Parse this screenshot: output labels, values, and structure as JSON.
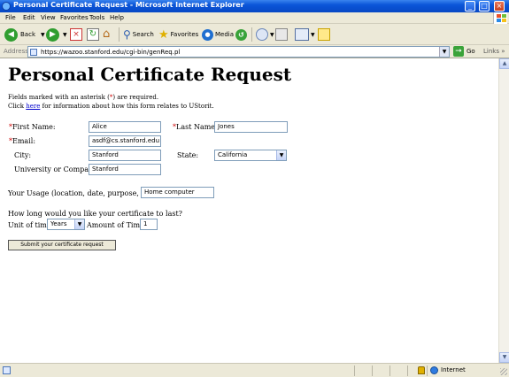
{
  "window": {
    "title": "Personal Certificate Request - Microsoft Internet Explorer",
    "minimize": "_",
    "maximize": "□",
    "close": "×"
  },
  "menu": [
    "File",
    "Edit",
    "View",
    "Favorites",
    "Tools",
    "Help"
  ],
  "toolbar": {
    "back": "Back",
    "search": "Search",
    "favorites": "Favorites",
    "media": "Media"
  },
  "address": {
    "label": "Address",
    "url": "https://wazoo.stanford.edu/cgi-bin/genReq.pl",
    "go": "Go",
    "links": "Links"
  },
  "page": {
    "title": "Personal Certificate Request",
    "required_note_pre": "Fields marked with an asterisk (",
    "asterisk": "*",
    "required_note_post": ") are required.",
    "click": "Click ",
    "here": "here",
    "info_post": " for information about how this form relates to UStorit."
  },
  "form": {
    "first_name_label": "First Name:",
    "first_name_value": "Alice",
    "last_name_label": "Last Name:",
    "last_name_value": "Jones",
    "email_label": "Email:",
    "email_value": "asdf@cs.stanford.edu",
    "city_label": "City:",
    "city_value": "Stanford",
    "state_label": "State:",
    "state_value": "California",
    "university_label": "University or Company:",
    "university_value": "Stanford",
    "usage_label": "Your Usage (location, date, purpose, etc.):",
    "usage_value": "Home computer",
    "duration_question": "How long would you like your certificate to last?",
    "unit_label": "Unit of time:",
    "unit_value": "Years",
    "amount_label": "Amount of Time:",
    "amount_value": "1",
    "submit_label": "Submit your certificate request"
  },
  "status": {
    "zone": "Internet"
  }
}
